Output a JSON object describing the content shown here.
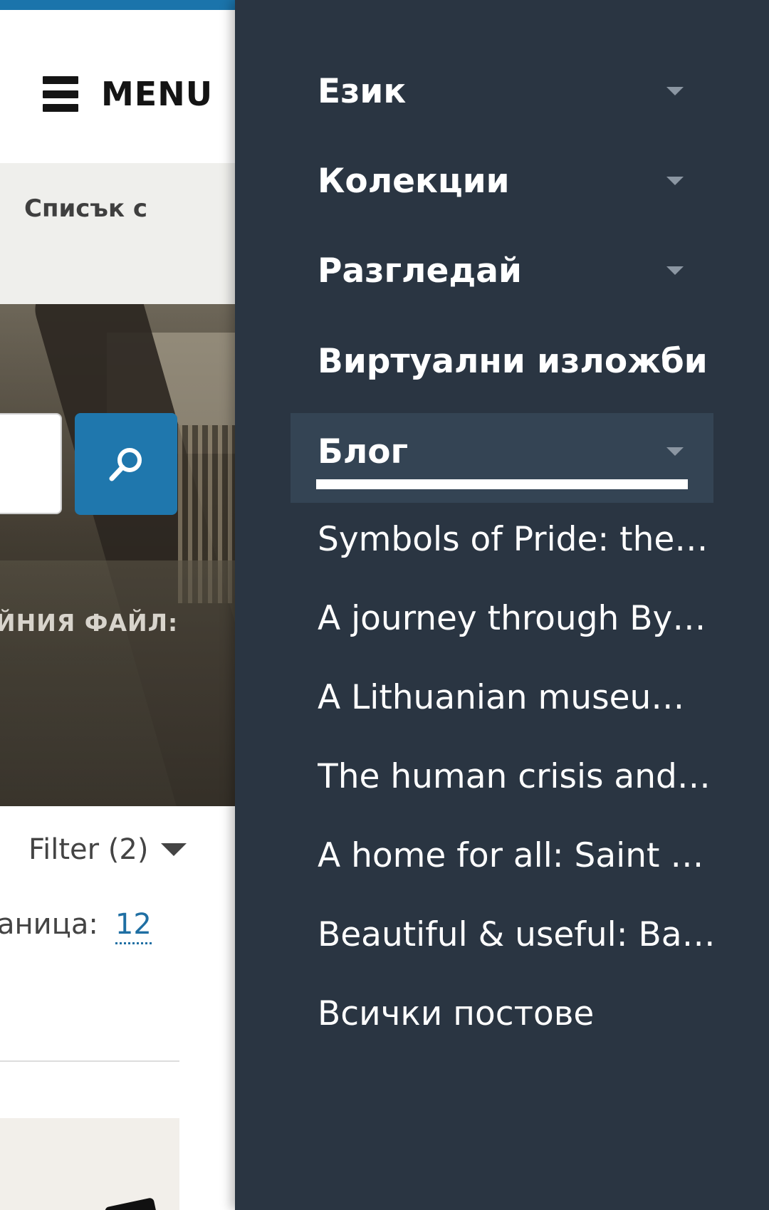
{
  "header": {
    "menu_label": "MENU"
  },
  "band": {
    "text": "Списък с"
  },
  "hero": {
    "search_placeholder": "",
    "caption": "ЙНИЯ ФАЙЛ:"
  },
  "results": {
    "filter_label": "Filter (2)",
    "per_page_label": "аница:",
    "per_page_value": "12"
  },
  "drawer": {
    "items": [
      {
        "label": "Език",
        "has_dropdown": true
      },
      {
        "label": "Колекции",
        "has_dropdown": true
      },
      {
        "label": "Разгледай",
        "has_dropdown": true
      },
      {
        "label": "Виртуални изложби",
        "has_dropdown": false
      },
      {
        "label": "Блог",
        "has_dropdown": true,
        "active": true
      }
    ],
    "blog_posts": [
      "Symbols of Pride: the c...",
      "A journey through Byz...",
      "A Lithuanian museum ...",
      "The human crisis and t...",
      "A home for all: Saint Pa...",
      "Beautiful & useful: Bau...",
      "Всички постове"
    ]
  },
  "colors": {
    "drawer_bg": "#2a3542",
    "active_bg": "#344454",
    "accent_blue": "#1f77ad",
    "top_bar": "#1b74ab",
    "link_blue": "#1f6fa3"
  },
  "icons": {
    "menu": "hamburger-icon",
    "search": "magnifier-icon",
    "dropdown": "caret-down-icon"
  }
}
